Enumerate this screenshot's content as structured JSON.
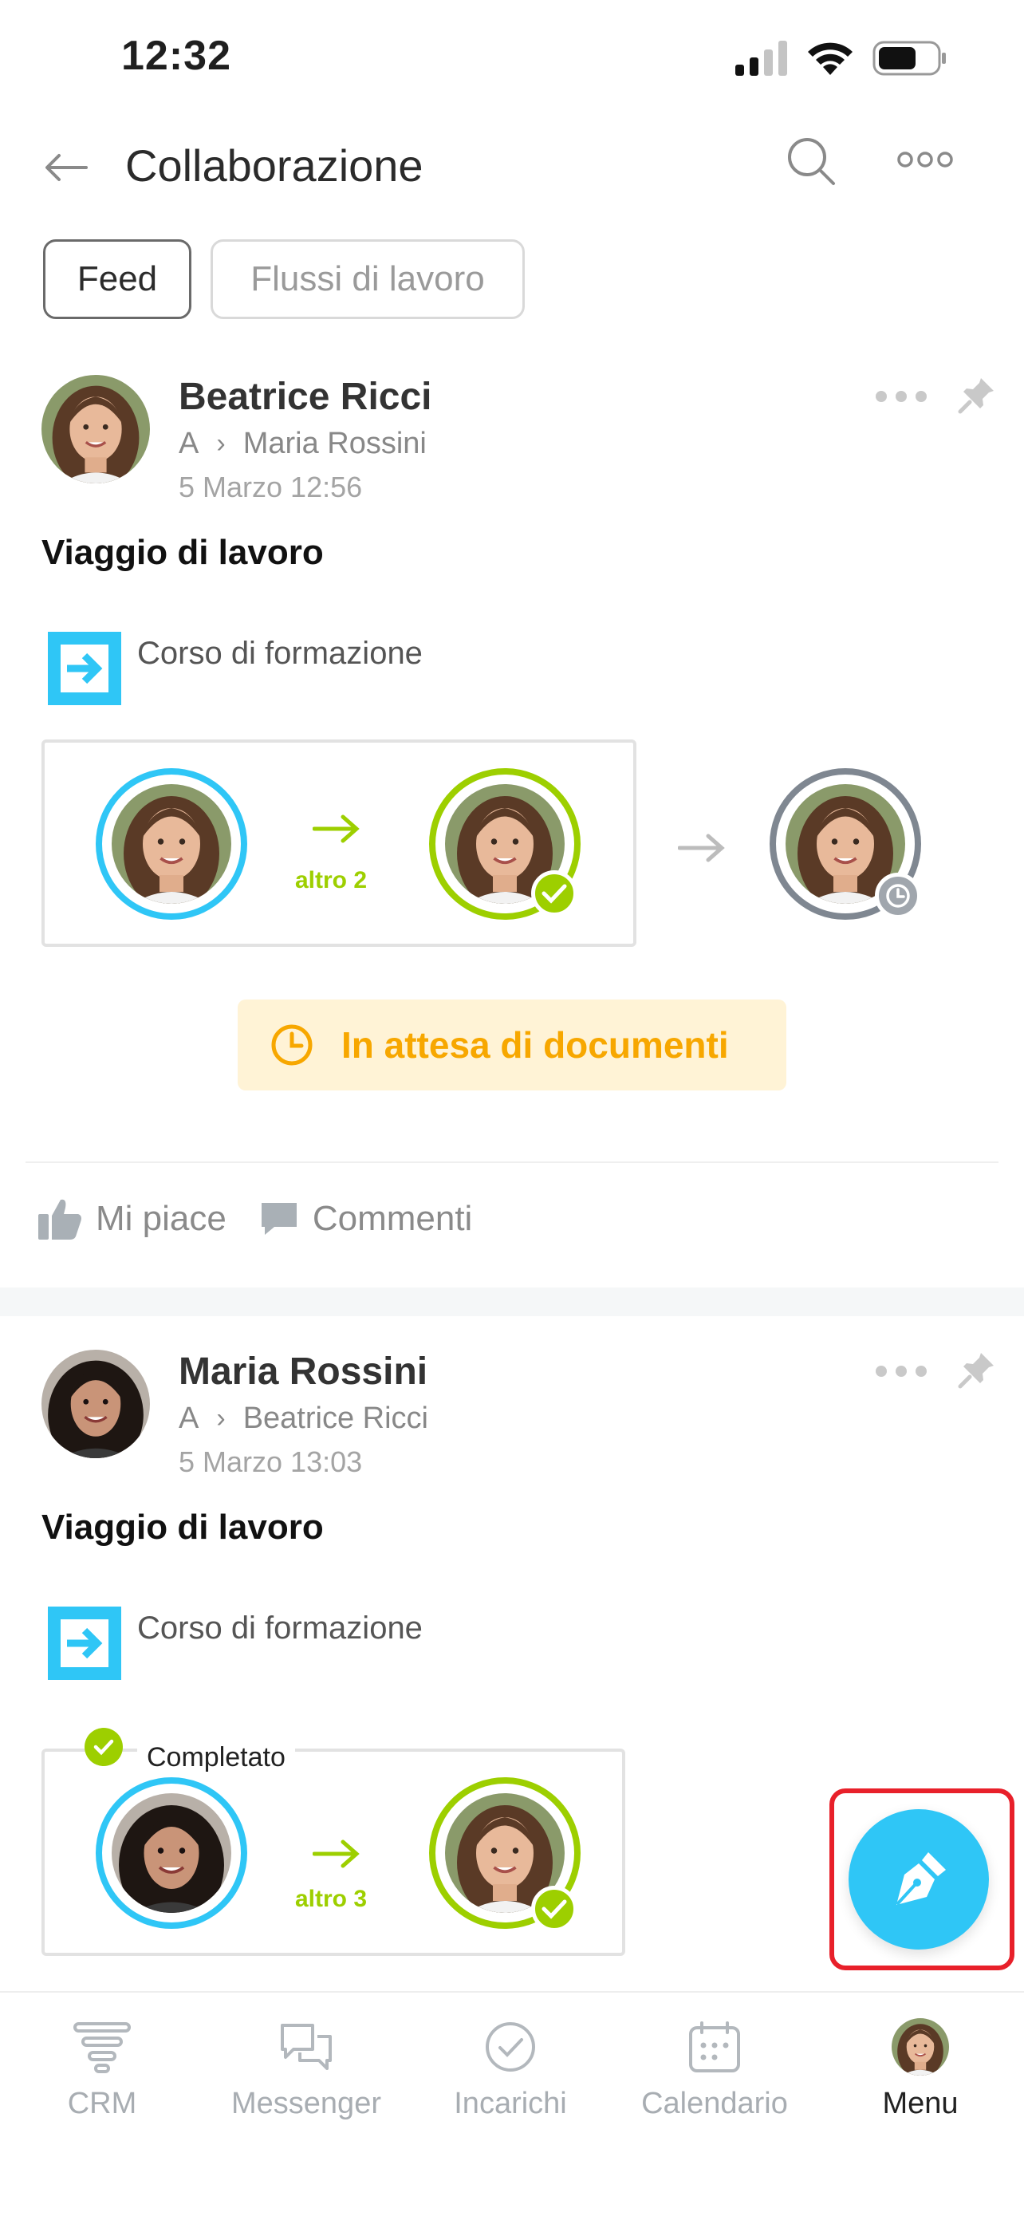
{
  "status_bar": {
    "time": "12:32"
  },
  "header": {
    "title": "Collaborazione"
  },
  "tabs": [
    {
      "label": "Feed",
      "active": true
    },
    {
      "label": "Flussi di lavoro",
      "active": false
    }
  ],
  "posts": [
    {
      "author": "Beatrice Ricci",
      "recipient_prefix": "A",
      "recipient": "Maria Rossini",
      "date": "5 Marzo 12:56",
      "title": "Viaggio di lavoro",
      "workflow": "Corso di formazione",
      "more_label": "altro 2",
      "status": "In attesa di documenti",
      "like_label": "Mi piace",
      "comments_label": "Commenti"
    },
    {
      "author": "Maria Rossini",
      "recipient_prefix": "A",
      "recipient": "Beatrice Ricci",
      "date": "5 Marzo 13:03",
      "title": "Viaggio di lavoro",
      "workflow": "Corso di formazione",
      "completed_label": "Completato",
      "more_label": "altro 3"
    }
  ],
  "bottom_nav": [
    {
      "label": "CRM",
      "icon": "funnel-icon",
      "active": false
    },
    {
      "label": "Messenger",
      "icon": "chat-bubbles-icon",
      "active": false
    },
    {
      "label": "Incarichi",
      "icon": "check-circle-icon",
      "active": false
    },
    {
      "label": "Calendario",
      "icon": "calendar-icon",
      "active": false
    },
    {
      "label": "Menu",
      "icon": "user-avatar",
      "active": true
    }
  ],
  "colors": {
    "accent_blue": "#2fc6f6",
    "accent_green": "#9dcf00",
    "pending_orange": "#f7a700",
    "pending_bg": "#fff3d6",
    "highlight_red": "#e8202a"
  }
}
